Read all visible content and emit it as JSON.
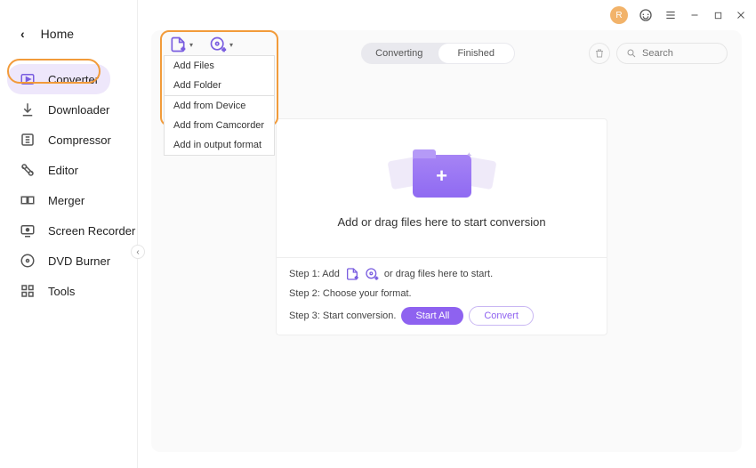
{
  "titlebar": {
    "avatar_initial": "R"
  },
  "sidebar": {
    "home_label": "Home",
    "items": [
      {
        "label": "Converter"
      },
      {
        "label": "Downloader"
      },
      {
        "label": "Compressor"
      },
      {
        "label": "Editor"
      },
      {
        "label": "Merger"
      },
      {
        "label": "Screen Recorder"
      },
      {
        "label": "DVD Burner"
      },
      {
        "label": "Tools"
      }
    ]
  },
  "dropdown": {
    "items": [
      "Add Files",
      "Add Folder",
      "Add from Device",
      "Add from Camcorder",
      "Add in output format"
    ]
  },
  "segmented": {
    "converting": "Converting",
    "finished": "Finished"
  },
  "search": {
    "placeholder": "Search"
  },
  "center": {
    "drop_text": "Add or drag files here to start conversion",
    "step1_pre": "Step 1: Add",
    "step1_post": "or drag files here to start.",
    "step2": "Step 2: Choose your format.",
    "step3": "Step 3: Start conversion.",
    "start_all": "Start All",
    "convert": "Convert"
  },
  "colors": {
    "accent": "#8e62f0",
    "highlight": "#f29b3a"
  }
}
